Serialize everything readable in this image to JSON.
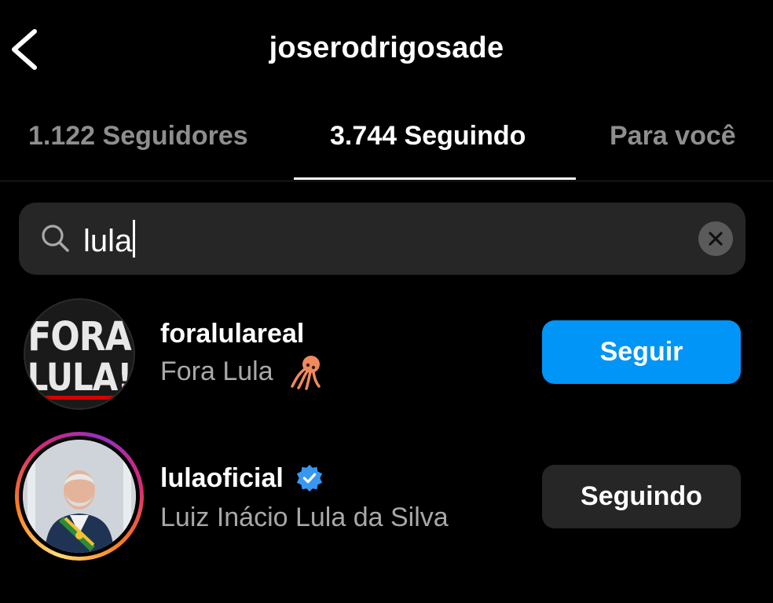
{
  "header": {
    "title": "joserodrigosade"
  },
  "tabs": [
    {
      "label": "1.122 Seguidores"
    },
    {
      "label": "3.744 Seguindo"
    },
    {
      "label": "Para você"
    }
  ],
  "search": {
    "value": "lula"
  },
  "results": [
    {
      "username": "foralulareal",
      "full_name": "Fora Lula",
      "button": "Seguir",
      "avatar_text": [
        "FORA",
        "LULA!"
      ]
    },
    {
      "username": "lulaoficial",
      "full_name": "Luiz Inácio Lula da Silva",
      "button": "Seguindo",
      "verified": true
    }
  ],
  "colors": {
    "background": "#000000",
    "follow_button": "#0095f6",
    "verified": "#3897f0",
    "secondary_text": "#a8a8a8"
  },
  "icons": {
    "back": "chevron-left-icon",
    "search": "search-icon",
    "clear": "clear-circle-icon",
    "verified": "verified-badge-icon",
    "emoji": "squid-emoji-icon"
  }
}
